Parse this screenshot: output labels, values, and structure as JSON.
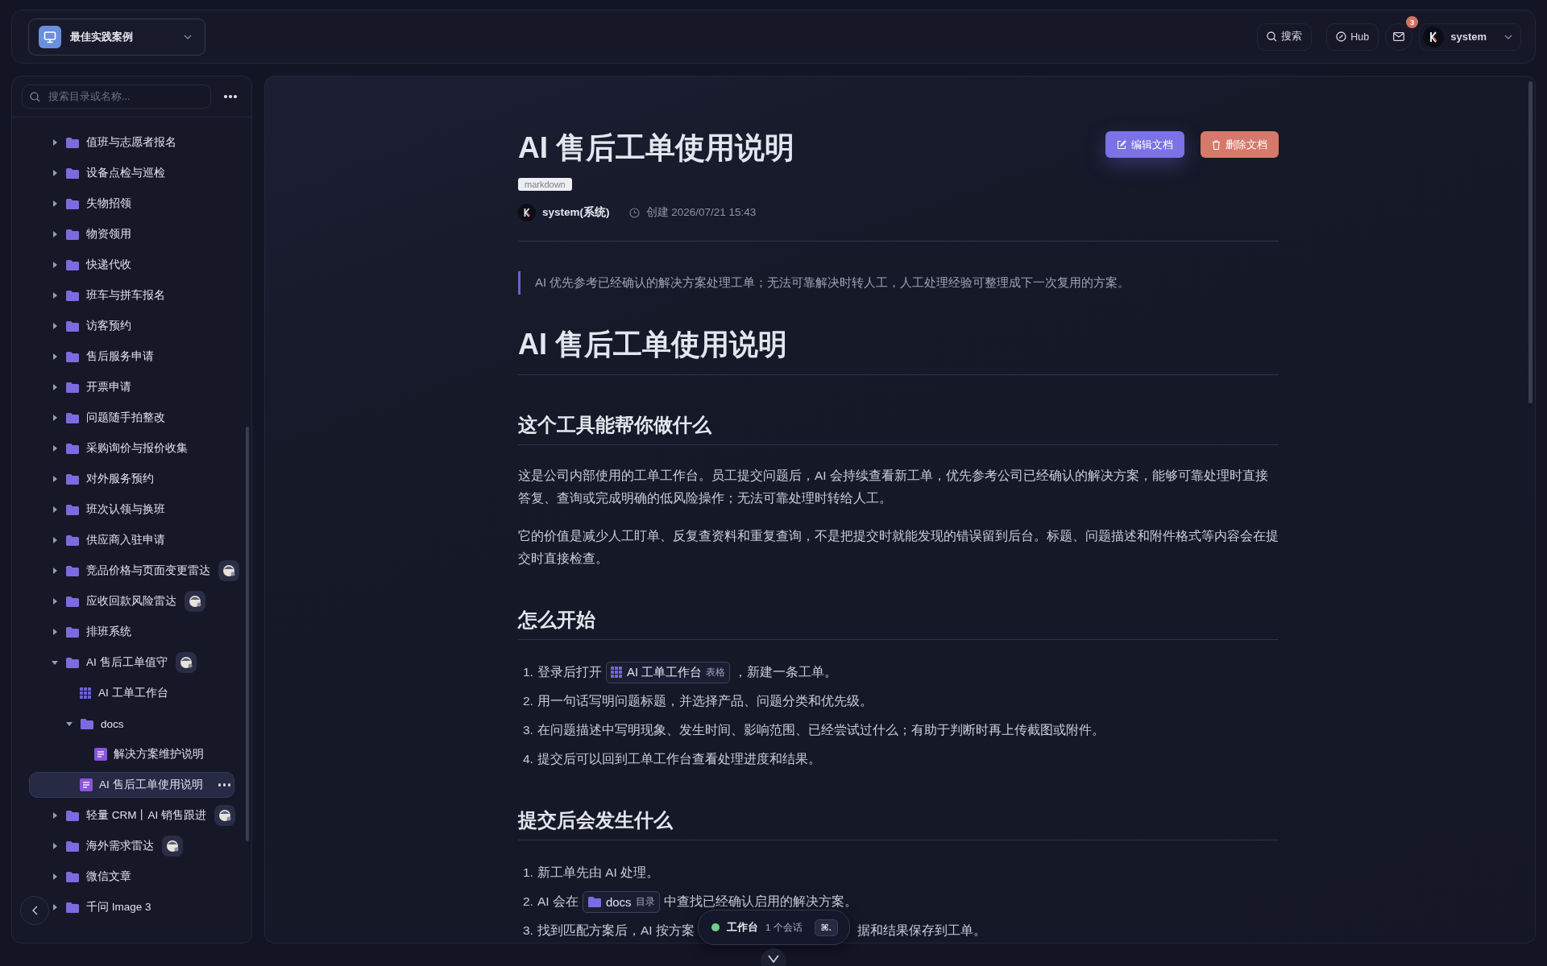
{
  "workspace": {
    "name": "最佳实践案例"
  },
  "topbar": {
    "search": "搜索",
    "hub": "Hub",
    "mail_count": "3",
    "user": "system"
  },
  "sidebar": {
    "search_placeholder": "搜索目录或名称...",
    "tree": [
      {
        "label": "值班与志愿者报名",
        "kind": "folder",
        "expanded": false,
        "selected": false
      },
      {
        "label": "设备点检与巡检",
        "kind": "folder",
        "expanded": false,
        "selected": false
      },
      {
        "label": "失物招领",
        "kind": "folder",
        "expanded": false,
        "selected": false
      },
      {
        "label": "物资领用",
        "kind": "folder",
        "expanded": false,
        "selected": false
      },
      {
        "label": "快递代收",
        "kind": "folder",
        "expanded": false,
        "selected": false
      },
      {
        "label": "班车与拼车报名",
        "kind": "folder",
        "expanded": false,
        "selected": false
      },
      {
        "label": "访客预约",
        "kind": "folder",
        "expanded": false,
        "selected": false
      },
      {
        "label": "售后服务申请",
        "kind": "folder",
        "expanded": false,
        "selected": false
      },
      {
        "label": "开票申请",
        "kind": "folder",
        "expanded": false,
        "selected": false
      },
      {
        "label": "问题随手拍整改",
        "kind": "folder",
        "expanded": false,
        "selected": false
      },
      {
        "label": "采购询价与报价收集",
        "kind": "folder",
        "expanded": false,
        "selected": false
      },
      {
        "label": "对外服务预约",
        "kind": "folder",
        "expanded": false,
        "selected": false
      },
      {
        "label": "班次认领与换班",
        "kind": "folder",
        "expanded": false,
        "selected": false
      },
      {
        "label": "供应商入驻申请",
        "kind": "folder",
        "expanded": false,
        "selected": false
      },
      {
        "label": "竞品价格与页面变更雷达",
        "kind": "folder",
        "expanded": false,
        "selected": false,
        "agent": true
      },
      {
        "label": "应收回款风险雷达",
        "kind": "folder",
        "expanded": false,
        "selected": false,
        "agent": true
      },
      {
        "label": "排班系统",
        "kind": "folder",
        "expanded": false,
        "selected": false
      },
      {
        "label": "AI 售后工单值守",
        "kind": "folder",
        "expanded": true,
        "selected": false,
        "agent": true,
        "children": [
          {
            "label": "AI 工单工作台",
            "kind": "table",
            "selected": false
          },
          {
            "label": "docs",
            "kind": "folder",
            "expanded": true,
            "selected": false,
            "children": [
              {
                "label": "解决方案维护说明",
                "kind": "doc",
                "selected": false
              }
            ]
          },
          {
            "label": "AI 售后工单使用说明",
            "kind": "doc",
            "selected": true
          }
        ]
      },
      {
        "label": "轻量 CRM丨AI 销售跟进",
        "kind": "folder",
        "expanded": false,
        "selected": false,
        "agent": true
      },
      {
        "label": "海外需求雷达",
        "kind": "folder",
        "expanded": false,
        "selected": false,
        "agent": true
      },
      {
        "label": "微信文章",
        "kind": "folder",
        "expanded": false,
        "selected": false
      },
      {
        "label": "千问 Image 3",
        "kind": "folder",
        "expanded": false,
        "selected": false
      }
    ]
  },
  "document": {
    "title": "AI 售后工单使用说明",
    "format": "markdown",
    "author": "system(系统)",
    "created": "创建 2026/07/21 15:43",
    "actions": [
      {
        "label": "编辑文档",
        "kind": "edit"
      },
      {
        "label": "删除文档",
        "kind": "delete"
      }
    ],
    "body": [
      {
        "kind": "quote",
        "text": "AI 优先参考已经确认的解决方案处理工单；无法可靠解决时转人工，人工处理经验可整理成下一次复用的方案。"
      },
      {
        "kind": "h1",
        "text": "AI 售后工单使用说明"
      },
      {
        "kind": "h2",
        "text": "这个工具能帮你做什么"
      },
      {
        "kind": "p",
        "text": "这是公司内部使用的工单工作台。员工提交问题后，AI 会持续查看新工单，优先参考公司已经确认的解决方案，能够可靠处理时直接答复、查询或完成明确的低风险操作；无法可靠处理时转给人工。"
      },
      {
        "kind": "p",
        "text": "它的价值是减少人工盯单、反复查资料和重复查询，不是把提交时就能发现的错误留到后台。标题、问题描述和附件格式等内容会在提交时直接检查。"
      },
      {
        "kind": "h2",
        "text": "怎么开始"
      },
      {
        "kind": "ol",
        "items": [
          {
            "number": "1.",
            "parts": [
              {
                "kind": "text",
                "text": "登录后打开"
              },
              {
                "kind": "table_ref",
                "name": "AI 工单工作台",
                "type": "表格"
              },
              {
                "kind": "text",
                "text": "，新建一条工单。"
              }
            ]
          },
          {
            "number": "2.",
            "parts": [
              {
                "kind": "text",
                "text": "用一句话写明问题标题，并选择产品、问题分类和优先级。"
              }
            ]
          },
          {
            "number": "3.",
            "parts": [
              {
                "kind": "text",
                "text": "在问题描述中写明现象、发生时间、影响范围、已经尝试过什么；有助于判断时再上传截图或附件。"
              }
            ]
          },
          {
            "number": "4.",
            "parts": [
              {
                "kind": "text",
                "text": "提交后可以回到工单工作台查看处理进度和结果。"
              }
            ]
          }
        ]
      },
      {
        "kind": "h2",
        "text": "提交后会发生什么"
      },
      {
        "kind": "ol",
        "items": [
          {
            "number": "1.",
            "parts": [
              {
                "kind": "text",
                "text": "新工单先由 AI 处理。"
              }
            ]
          },
          {
            "number": "2.",
            "parts": [
              {
                "kind": "text",
                "text": "AI 会在"
              },
              {
                "kind": "folder_ref",
                "name": "docs",
                "type": "目录"
              },
              {
                "kind": "text",
                "text": "中查找已经确认启用的解决方案。"
              }
            ]
          },
          {
            "number": "3.",
            "parts": [
              {
                "kind": "text",
                "text": "找到匹配方案后，AI 按方案"
              },
              {
                "kind": "covered"
              },
              {
                "kind": "text",
                "text": "据和结果保存到工单。"
              }
            ]
          }
        ]
      }
    ]
  },
  "session_pill": {
    "label": "工作台",
    "count": "1 个会话",
    "shortcut": "⌘."
  }
}
